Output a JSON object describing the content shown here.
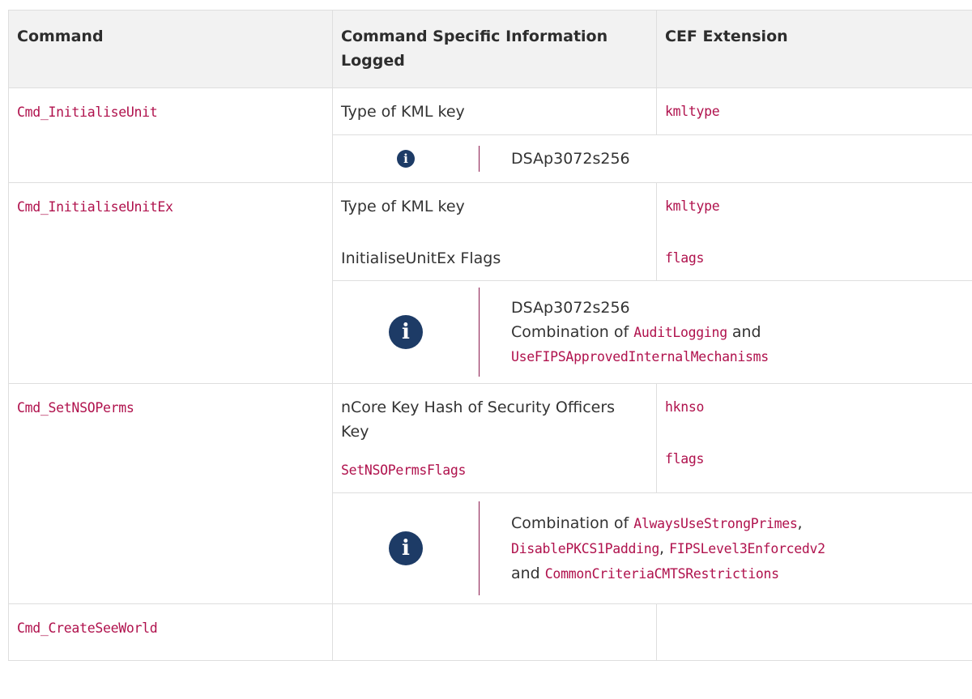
{
  "header": {
    "col1": "Command",
    "col2": "Command Specific Information Logged",
    "col3": "CEF Extension"
  },
  "rows": [
    {
      "command": "Cmd_InitialiseUnit",
      "info": [
        "Type of KML key"
      ],
      "cef": [
        "kmltype"
      ],
      "note": {
        "line1": "DSAp3072s256"
      }
    },
    {
      "command": "Cmd_InitialiseUnitEx",
      "info": [
        "Type of KML key",
        "InitialiseUnitEx Flags"
      ],
      "cef": [
        "kmltype",
        "flags"
      ],
      "note": {
        "line1": "DSAp3072s256",
        "combo_prefix": "Combination of",
        "code1": "AuditLogging",
        "and": "and",
        "code2": "UseFIPSApprovedInternalMechanisms"
      }
    },
    {
      "command": "Cmd_SetNSOPerms",
      "info": [
        "nCore Key Hash of Security Officers Key",
        "SetNSOPermsFlags"
      ],
      "cef": [
        "hknso",
        "flags"
      ],
      "note": {
        "combo_prefix": "Combination of",
        "code1": "AlwaysUseStrongPrimes",
        "comma1": ",",
        "code2": "DisablePKCS1Padding",
        "comma2": ",",
        "code3": "FIPSLevel3Enforcedv2",
        "and": "and",
        "code4": "CommonCriteriaCMTSRestrictions"
      }
    },
    {
      "command": "Cmd_CreateSeeWorld"
    }
  ],
  "icons": {
    "note": "info-circle-icon",
    "note_glyph": "i"
  },
  "colors": {
    "code": "#b0124d",
    "icon": "#1d3b66",
    "bar": "#8c1a4f",
    "header_bg": "#f2f2f2",
    "border": "#dedede"
  }
}
